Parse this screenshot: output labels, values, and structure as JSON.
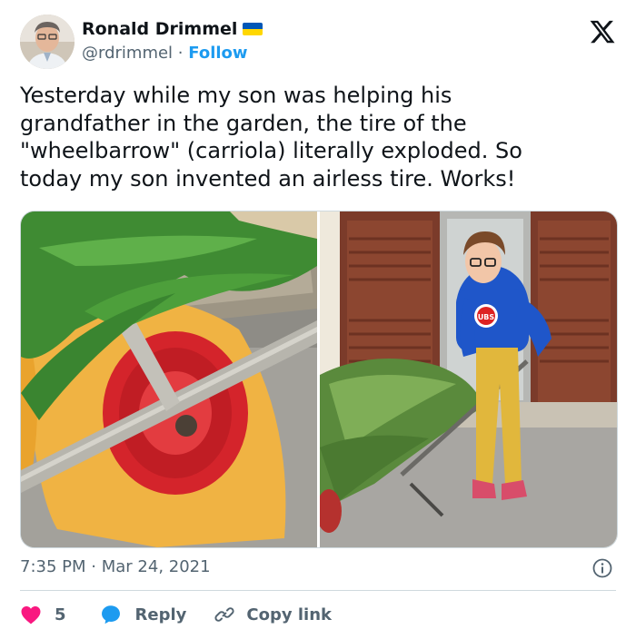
{
  "author": {
    "display_name": "Ronald Drimmel",
    "handle": "@rdrimmel",
    "separator": "·",
    "follow_label": "Follow",
    "flag_colors": {
      "top": "#0057b7",
      "bottom": "#ffd700"
    }
  },
  "tweet": {
    "text": "Yesterday while my son was helping his\ngrandfather in the garden, the tire of the\n\"wheelbarrow\" (carriola) literally exploded. So\ntoday my son invented an airless tire. Works!"
  },
  "media": {
    "photos": [
      {
        "icon": "wheelbarrow-wheel-photo"
      },
      {
        "icon": "boy-with-wheelbarrow-photo",
        "shirt_logo": "UBS"
      }
    ]
  },
  "meta": {
    "time": "7:35 PM",
    "separator": "·",
    "date": "Mar 24, 2021"
  },
  "actions": {
    "like_count": "5",
    "reply_label": "Reply",
    "copy_label": "Copy link"
  },
  "colors": {
    "accent": "#1d9bf0",
    "like": "#f91880",
    "text": "#0f1419",
    "muted": "#536471"
  }
}
